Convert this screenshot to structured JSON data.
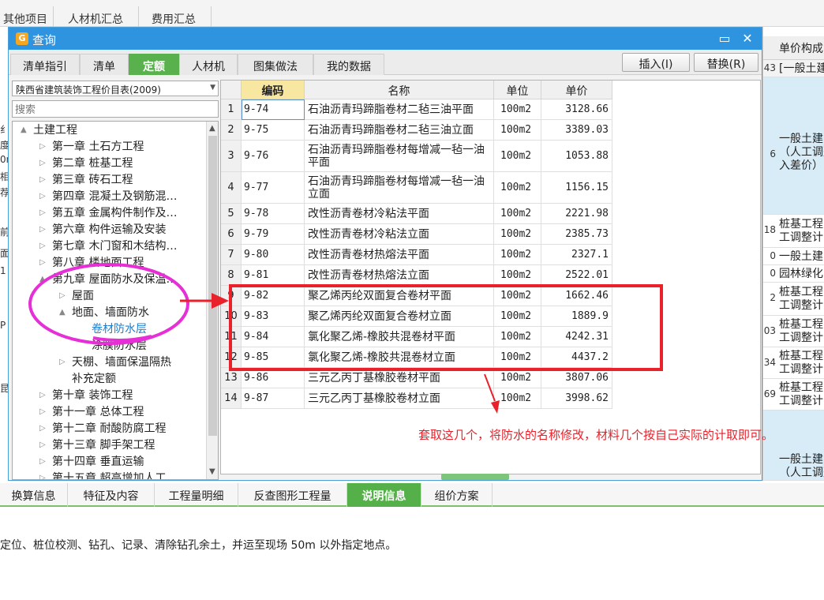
{
  "background": {
    "top_tabs": [
      "其他项目",
      "人材机汇总",
      "费用汇总"
    ],
    "right_header": "单价构成",
    "right_rows": [
      {
        "num": "43",
        "text": "[一般土建"
      },
      {
        "num": "6",
        "text": "一般土建\n（人工调整\n入差价）"
      },
      {
        "num": "18",
        "text": "桩基工程\n工调整计"
      },
      {
        "num": "0",
        "text": "一般土建"
      },
      {
        "num": "0",
        "text": "园林绿化"
      },
      {
        "num": "2",
        "text": "桩基工程\n工调整计"
      },
      {
        "num": "03",
        "text": "桩基工程\n工调整计"
      },
      {
        "num": "34",
        "text": "桩基工程\n工调整计"
      },
      {
        "num": "69",
        "text": "桩基工程\n工调整计"
      },
      {
        "num": "",
        "text": "一般土建\n（人工调整"
      }
    ],
    "left_strip": [
      "纟",
      "度",
      "0n",
      "相",
      "荐",
      "前",
      "面",
      "1",
      "P",
      "昆"
    ],
    "bottom_tabs": [
      "换算信息",
      "特征及内容",
      "工程量明细",
      "反查图形工程量",
      "说明信息",
      "组价方案"
    ],
    "bottom_active": "说明信息",
    "description": "定位、桩位校测、钻孔、记录、清除钻孔余土，并运至现场 50m 以外指定地点。"
  },
  "dialog": {
    "title": "查询",
    "tabs": [
      "清单指引",
      "清单",
      "定额",
      "人材机",
      "图集做法",
      "我的数据"
    ],
    "active_tab": "定额",
    "insert_button": "插入(I)",
    "replace_button": "替换(R)",
    "library": "陕西省建筑装饰工程价目表(2009)",
    "search_placeholder": "搜索",
    "tree": [
      {
        "label": "土建工程",
        "level": 0,
        "toggle": "▲"
      },
      {
        "label": "第一章 土石方工程",
        "level": 1,
        "toggle": "▷"
      },
      {
        "label": "第二章 桩基工程",
        "level": 1,
        "toggle": "▷"
      },
      {
        "label": "第三章 砖石工程",
        "level": 1,
        "toggle": "▷"
      },
      {
        "label": "第四章 混凝土及钢筋混…",
        "level": 1,
        "toggle": "▷"
      },
      {
        "label": "第五章 金属构件制作及…",
        "level": 1,
        "toggle": "▷"
      },
      {
        "label": "第六章 构件运输及安装",
        "level": 1,
        "toggle": "▷"
      },
      {
        "label": "第七章 木门窗和木结构…",
        "level": 1,
        "toggle": "▷"
      },
      {
        "label": "第八章 楼地面工程",
        "level": 1,
        "toggle": "▷"
      },
      {
        "label": "第九章 屋面防水及保温…",
        "level": 1,
        "toggle": "▲"
      },
      {
        "label": "屋面",
        "level": 2,
        "toggle": "▷"
      },
      {
        "label": "地面、墙面防水",
        "level": 2,
        "toggle": "▲"
      },
      {
        "label": "卷材防水层",
        "level": 3,
        "toggle": "",
        "selected": true
      },
      {
        "label": "涂膜防水层",
        "level": 3,
        "toggle": ""
      },
      {
        "label": "天棚、墙面保温隔热",
        "level": 2,
        "toggle": "▷"
      },
      {
        "label": "补充定额",
        "level": 2,
        "toggle": ""
      },
      {
        "label": "第十章 装饰工程",
        "level": 1,
        "toggle": "▷"
      },
      {
        "label": "第十一章 总体工程",
        "level": 1,
        "toggle": "▷"
      },
      {
        "label": "第十二章 耐酸防腐工程",
        "level": 1,
        "toggle": "▷"
      },
      {
        "label": "第十三章 脚手架工程",
        "level": 1,
        "toggle": "▷"
      },
      {
        "label": "第十四章 垂直运输",
        "level": 1,
        "toggle": "▷"
      },
      {
        "label": "第十五章 超高增加人工…",
        "level": 1,
        "toggle": "▷"
      }
    ],
    "table": {
      "headers": [
        "编码",
        "名称",
        "单位",
        "单价"
      ],
      "rows": [
        {
          "idx": "1",
          "code": "9-74",
          "name": "石油沥青玛蹄脂卷材二毡三油平面",
          "unit": "100m2",
          "price": "3128.66"
        },
        {
          "idx": "2",
          "code": "9-75",
          "name": "石油沥青玛蹄脂卷材二毡三油立面",
          "unit": "100m2",
          "price": "3389.03"
        },
        {
          "idx": "3",
          "code": "9-76",
          "name": "石油沥青玛蹄脂卷材每增减一毡一油平面",
          "unit": "100m2",
          "price": "1053.88"
        },
        {
          "idx": "4",
          "code": "9-77",
          "name": "石油沥青玛蹄脂卷材每增减一毡一油立面",
          "unit": "100m2",
          "price": "1156.15"
        },
        {
          "idx": "5",
          "code": "9-78",
          "name": "改性沥青卷材冷粘法平面",
          "unit": "100m2",
          "price": "2221.98"
        },
        {
          "idx": "6",
          "code": "9-79",
          "name": "改性沥青卷材冷粘法立面",
          "unit": "100m2",
          "price": "2385.73"
        },
        {
          "idx": "7",
          "code": "9-80",
          "name": "改性沥青卷材热熔法平面",
          "unit": "100m2",
          "price": "2327.1"
        },
        {
          "idx": "8",
          "code": "9-81",
          "name": "改性沥青卷材热熔法立面",
          "unit": "100m2",
          "price": "2522.01"
        },
        {
          "idx": "9",
          "code": "9-82",
          "name": "聚乙烯丙纶双面复合卷材平面",
          "unit": "100m2",
          "price": "1662.46"
        },
        {
          "idx": "10",
          "code": "9-83",
          "name": "聚乙烯丙纶双面复合卷材立面",
          "unit": "100m2",
          "price": "1889.9"
        },
        {
          "idx": "11",
          "code": "9-84",
          "name": "氯化聚乙烯-橡胶共混卷材平面",
          "unit": "100m2",
          "price": "4242.31"
        },
        {
          "idx": "12",
          "code": "9-85",
          "name": "氯化聚乙烯-橡胶共混卷材立面",
          "unit": "100m2",
          "price": "4437.2"
        },
        {
          "idx": "13",
          "code": "9-86",
          "name": "三元乙丙丁基橡胶卷材平面",
          "unit": "100m2",
          "price": "3807.06"
        },
        {
          "idx": "14",
          "code": "9-87",
          "name": "三元乙丙丁基橡胶卷材立面",
          "unit": "100m2",
          "price": "3998.62"
        }
      ]
    }
  },
  "annotation_text": "套取这几个，将防水的名称修改，材料几个按自己实际的计取即可。",
  "colors": {
    "accent_green": "#58b14c",
    "title_blue": "#2f94e0",
    "annotation_red": "#e8212a",
    "highlight_magenta": "#e62fd6"
  }
}
